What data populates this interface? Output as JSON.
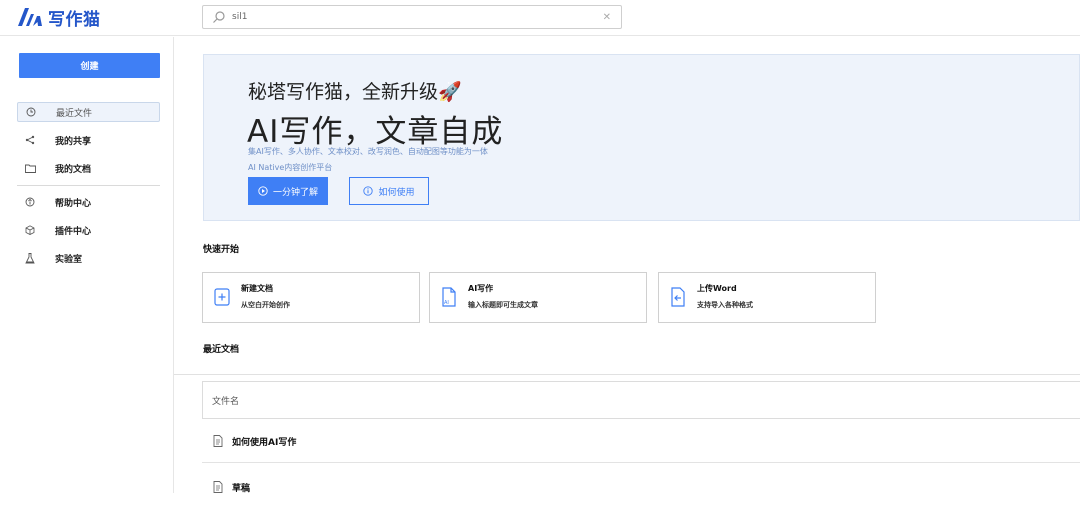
{
  "header": {
    "logo_text": "写作猫",
    "brand_color": "#2456c9",
    "search": {
      "value": "sil1",
      "clear_icon": "close-icon"
    }
  },
  "sidebar": {
    "create_label": "创建",
    "items": [
      {
        "label": "最近文件",
        "icon": "clock-icon",
        "active": true
      },
      {
        "label": "我的共享",
        "icon": "share-icon",
        "active": false
      },
      {
        "label": "我的文档",
        "icon": "folder-icon",
        "active": false
      },
      {
        "label": "帮助中心",
        "icon": "help-icon",
        "active": false
      },
      {
        "label": "插件中心",
        "icon": "cube-icon",
        "active": false
      },
      {
        "label": "实验室",
        "icon": "flask-icon",
        "active": false
      }
    ]
  },
  "banner": {
    "subtitle": "秘塔写作猫，全新升级🚀",
    "title": "AI写作，文章自成",
    "desc1": "集AI写作、多人协作、文本校对、改写润色、自动配图等功能为一体",
    "desc2": "AI Native内容创作平台",
    "primary_button": "一分钟了解",
    "secondary_button": "如何使用"
  },
  "quick_start": {
    "title": "快速开始",
    "cards": [
      {
        "title": "新建文档",
        "desc": "从空白开始创作",
        "icon": "plus-doc-icon"
      },
      {
        "title": "AI写作",
        "desc": "输入标题即可生成文章",
        "icon": "ai-doc-icon"
      },
      {
        "title": "上传Word",
        "desc": "支持导入各种格式",
        "icon": "upload-doc-icon"
      }
    ]
  },
  "recent": {
    "title": "最近文档",
    "column_header": "文件名",
    "files": [
      {
        "name": "如何使用AI写作",
        "icon": "file-icon"
      },
      {
        "name": "草稿",
        "icon": "file-icon"
      }
    ]
  },
  "colors": {
    "accent": "#3f7ff5",
    "banner_bg": "#eef3fb"
  }
}
